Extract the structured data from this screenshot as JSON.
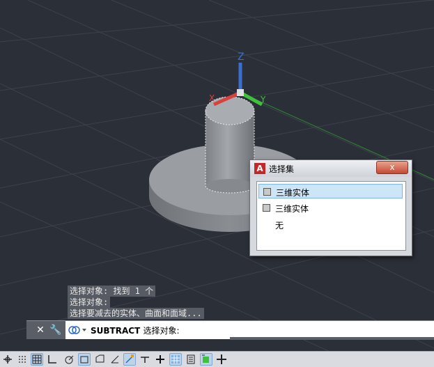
{
  "viewport": {
    "axis_x_label": "X",
    "axis_y_label": "Y",
    "axis_z_label": "Z",
    "colors": {
      "background": "#2b2f38",
      "grid": "#3d414b",
      "solid": "#8c9095",
      "x_axis": "#d9413b",
      "y_axis": "#3ec23a",
      "z_axis": "#3a6fd0"
    }
  },
  "command_history": [
    "选择对象: 找到 1 个",
    "选择对象:",
    "选择要减去的实体、曲面和面域..."
  ],
  "command_line": {
    "command": "SUBTRACT",
    "prompt": "选择对象:"
  },
  "selection_popup": {
    "title": "选择集",
    "close_label": "x",
    "items": [
      {
        "label": "三维实体",
        "selected": true
      },
      {
        "label": "三维实体",
        "selected": false
      },
      {
        "label": "无",
        "selected": false
      }
    ]
  },
  "status_bar": {
    "buttons": [
      "model-space-icon",
      "grid-icon",
      "snap-icon",
      "ortho-icon",
      "polar-icon",
      "isodraft-icon",
      "osnap-track-icon",
      "osnap-icon",
      "dynucs-icon",
      "dynamic-input-icon",
      "lineweight-icon",
      "transparency-icon",
      "selection-cycling-icon",
      "3d-osnap-icon",
      "annotation-icon",
      "workspace-icon"
    ]
  }
}
